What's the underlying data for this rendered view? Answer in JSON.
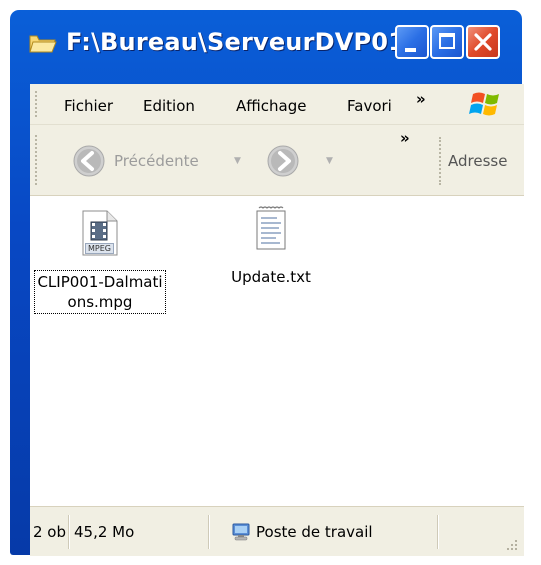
{
  "window": {
    "title": "F:\\Bureau\\ServeurDVP01",
    "icon": "folder-open-icon",
    "colors": {
      "titlebar": "#0a5fd8",
      "close_button": "#e04a2a",
      "chrome": "#f1efe3"
    }
  },
  "menubar": {
    "items": [
      {
        "label": "Fichier"
      },
      {
        "label": "Edition"
      },
      {
        "label": "Affichage"
      },
      {
        "label": "Favori"
      }
    ],
    "overflow_label": "»"
  },
  "toolbar": {
    "back_label": "Précédente",
    "overflow_label": "»",
    "address_label": "Adresse"
  },
  "files": [
    {
      "name": "CLIP001-Dalmations.mpg",
      "label_line1": "CLIP001-Dalmati",
      "label_line2": "ons.mpg",
      "icon": "mpeg-file-icon",
      "icon_text": "MPEG",
      "selected": true
    },
    {
      "name": "Update.txt",
      "label_line1": "Update.txt",
      "icon": "text-file-icon",
      "selected": false
    }
  ],
  "statusbar": {
    "objects": "2 ob",
    "size": "45,2 Mo",
    "location": "Poste de travail",
    "location_icon": "computer-icon"
  }
}
